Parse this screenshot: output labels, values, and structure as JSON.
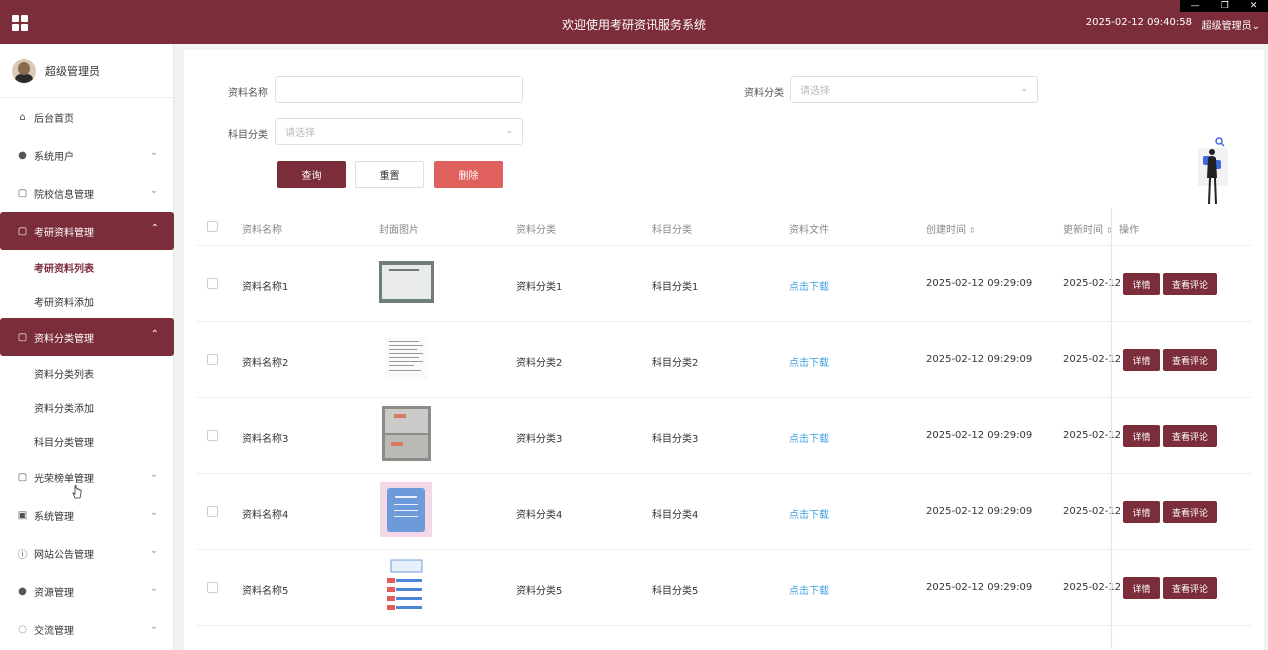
{
  "header": {
    "title": "欢迎使用考研资讯服务系统",
    "time": "2025-02-12 09:40:58",
    "user": "超级管理员",
    "user_chevron": "⌄"
  },
  "window": {
    "minimize": "—",
    "restore": "❐",
    "close": "✕"
  },
  "sidebar": {
    "profile_name": "超级管理员",
    "items": [
      {
        "label": "后台首页",
        "icon": "home-icon"
      },
      {
        "label": "系统用户",
        "icon": "user-icon"
      },
      {
        "label": "院校信息管理",
        "icon": "doc-icon"
      },
      {
        "label": "考研资料管理",
        "icon": "doc-icon",
        "sub": [
          "考研资料列表",
          "考研资料添加"
        ]
      },
      {
        "label": "资料分类管理",
        "icon": "doc-icon",
        "sub": [
          "资料分类列表",
          "资料分类添加",
          "科目分类管理"
        ]
      },
      {
        "label": "光荣榜单管理",
        "icon": "doc-icon"
      },
      {
        "label": "系统管理",
        "icon": "image-icon"
      },
      {
        "label": "网站公告管理",
        "icon": "info-icon"
      },
      {
        "label": "资源管理",
        "icon": "pin-icon"
      },
      {
        "label": "交流管理",
        "icon": "chat-icon"
      }
    ]
  },
  "search": {
    "name_label": "资料名称",
    "name_value": "",
    "category_label": "资料分类",
    "category_placeholder": "请选择",
    "subject_label": "科目分类",
    "subject_placeholder": "请选择",
    "query": "查询",
    "reset": "重置",
    "delete": "删除"
  },
  "table": {
    "headers": [
      "资料名称",
      "封面图片",
      "资料分类",
      "科目分类",
      "资料文件",
      "创建时间",
      "更新时间",
      "操作"
    ],
    "sort_glyph": "⇕",
    "rows": [
      {
        "name": "资料名称1",
        "category": "资料分类1",
        "subject": "科目分类1",
        "file": "点击下载",
        "created": "2025-02-12 09:29:09",
        "updated": "2025-02-12"
      },
      {
        "name": "资料名称2",
        "category": "资料分类2",
        "subject": "科目分类2",
        "file": "点击下载",
        "created": "2025-02-12 09:29:09",
        "updated": "2025-02-12"
      },
      {
        "name": "资料名称3",
        "category": "资料分类3",
        "subject": "科目分类3",
        "file": "点击下载",
        "created": "2025-02-12 09:29:09",
        "updated": "2025-02-12"
      },
      {
        "name": "资料名称4",
        "category": "资料分类4",
        "subject": "科目分类4",
        "file": "点击下载",
        "created": "2025-02-12 09:29:09",
        "updated": "2025-02-12"
      },
      {
        "name": "资料名称5",
        "category": "资料分类5",
        "subject": "科目分类5",
        "file": "点击下载",
        "created": "2025-02-12 09:29:09",
        "updated": "2025-02-12"
      }
    ],
    "detail_btn": "详情",
    "comment_btn": "查看评论"
  },
  "colors": {
    "primary": "#7b2d3a",
    "danger": "#e0605d",
    "link": "#3f9fe0"
  }
}
